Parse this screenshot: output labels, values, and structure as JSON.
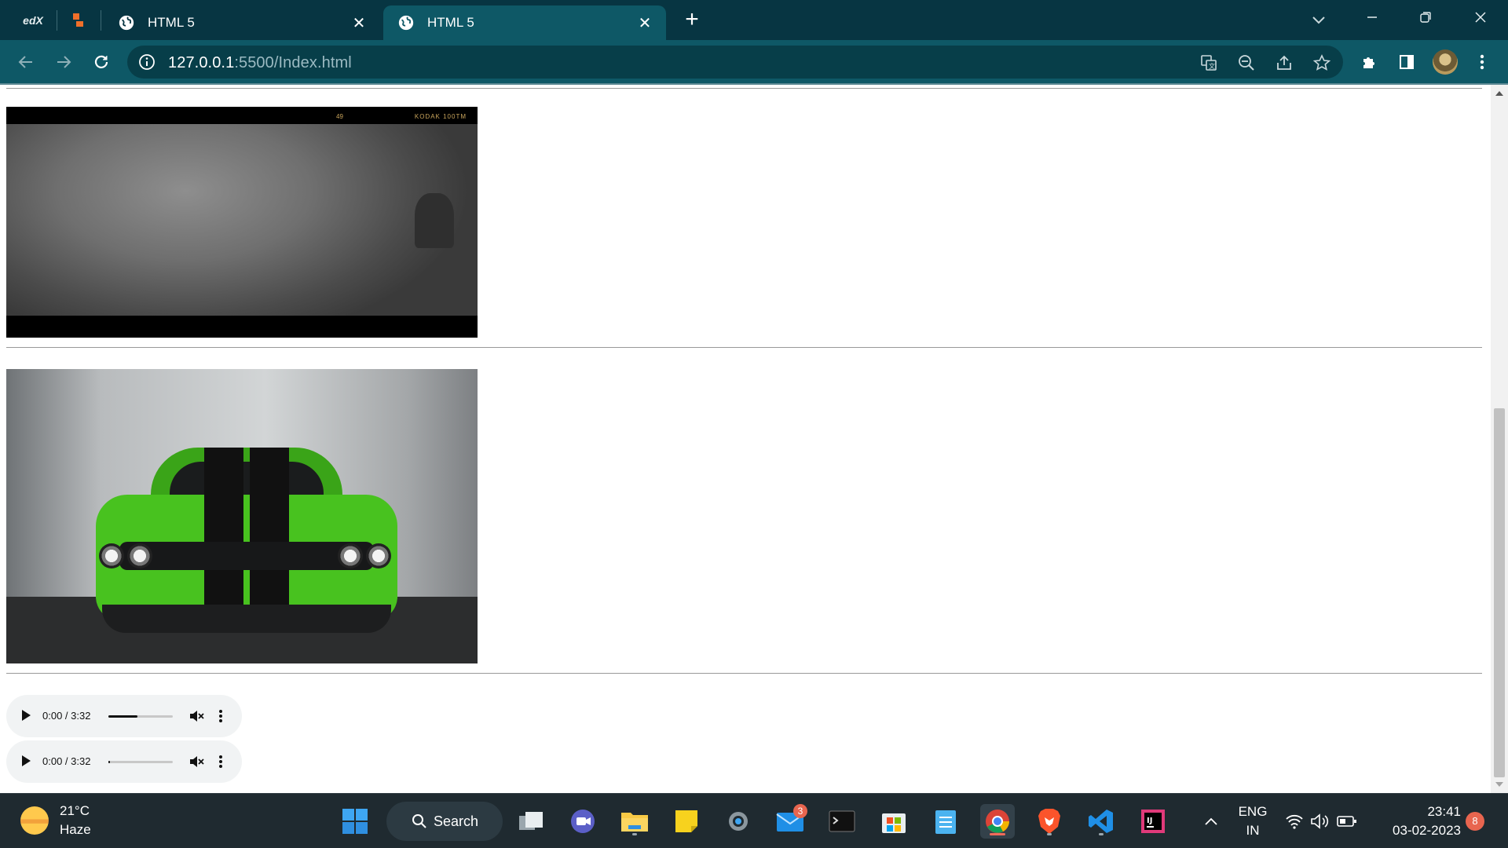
{
  "browser": {
    "pinned_tabs": [
      {
        "label": "edX",
        "icon": "edx-icon"
      },
      {
        "label": "",
        "icon": "gitlab-icon"
      }
    ],
    "tabs": [
      {
        "title": "HTML 5",
        "icon": "globe-icon",
        "active": false
      },
      {
        "title": "HTML 5",
        "icon": "globe-icon",
        "active": true
      }
    ],
    "new_tab_label": "+",
    "address": {
      "host": "127.0.0.1",
      "rest": ":5500/Index.html"
    },
    "colors": {
      "tabstrip": "#073542",
      "toolbar": "#0e5866"
    }
  },
  "page": {
    "video": {
      "overlay_text_left": "49",
      "overlay_text_right": "KODAK 100TM"
    },
    "image": {
      "alt": "green muscle car"
    },
    "audio_players": [
      {
        "time": "0:00 / 3:32",
        "volume": 0.45,
        "muted": true
      },
      {
        "time": "0:00 / 3:32",
        "volume": 0.0,
        "muted": true
      }
    ]
  },
  "taskbar": {
    "weather": {
      "temp": "21°C",
      "condition": "Haze"
    },
    "search_label": "Search",
    "apps": [
      {
        "name": "start-icon"
      },
      {
        "name": "search"
      },
      {
        "name": "task-view-icon"
      },
      {
        "name": "teams-icon"
      },
      {
        "name": "file-explorer-icon"
      },
      {
        "name": "sticky-notes-icon"
      },
      {
        "name": "settings-icon"
      },
      {
        "name": "mail-icon",
        "badge": "3"
      },
      {
        "name": "terminal-icon"
      },
      {
        "name": "store-icon"
      },
      {
        "name": "notepad-icon"
      },
      {
        "name": "chrome-icon"
      },
      {
        "name": "brave-icon"
      },
      {
        "name": "vscode-icon"
      },
      {
        "name": "intellij-icon"
      }
    ],
    "language": {
      "line1": "ENG",
      "line2": "IN"
    },
    "clock": {
      "time": "23:41",
      "date": "03-02-2023"
    },
    "notifications": "8"
  }
}
